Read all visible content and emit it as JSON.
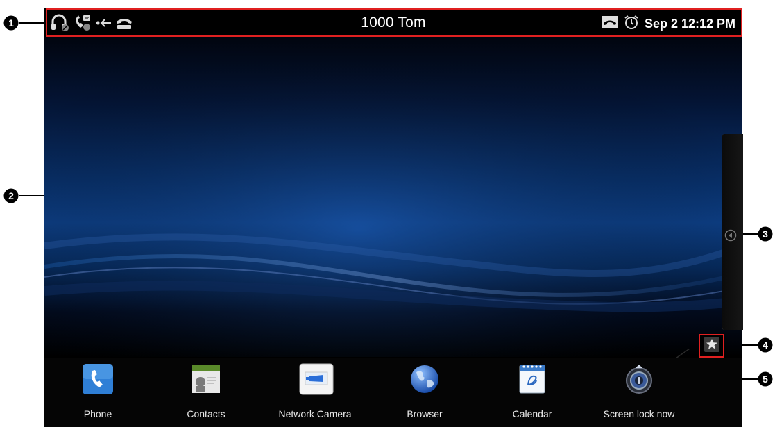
{
  "status_bar": {
    "left_icons": [
      "headset-muted-icon",
      "call-forward-icon",
      "missed-call-icon",
      "handset-icon"
    ],
    "caller_id": "1000  Tom",
    "right_icons": [
      "handset-onhook-icon",
      "alarm-clock-icon"
    ],
    "datetime": "Sep 2 12:12 PM"
  },
  "callouts": [
    "1",
    "2",
    "3",
    "4",
    "5"
  ],
  "dock": {
    "apps": [
      {
        "label": "Phone",
        "icon": "phone-icon"
      },
      {
        "label": "Contacts",
        "icon": "contacts-icon"
      },
      {
        "label": "Network Camera",
        "icon": "camera-icon"
      },
      {
        "label": "Browser",
        "icon": "globe-icon"
      },
      {
        "label": "Calendar",
        "icon": "calendar-icon"
      },
      {
        "label": "Screen lock now",
        "icon": "lock-icon"
      }
    ]
  },
  "side_panel": {
    "handle_icon": "arrow-left-icon"
  },
  "favorites": {
    "icon": "star-icon"
  },
  "colors": {
    "annotation": "#e02020",
    "accent_blue": "#0d3f86"
  }
}
